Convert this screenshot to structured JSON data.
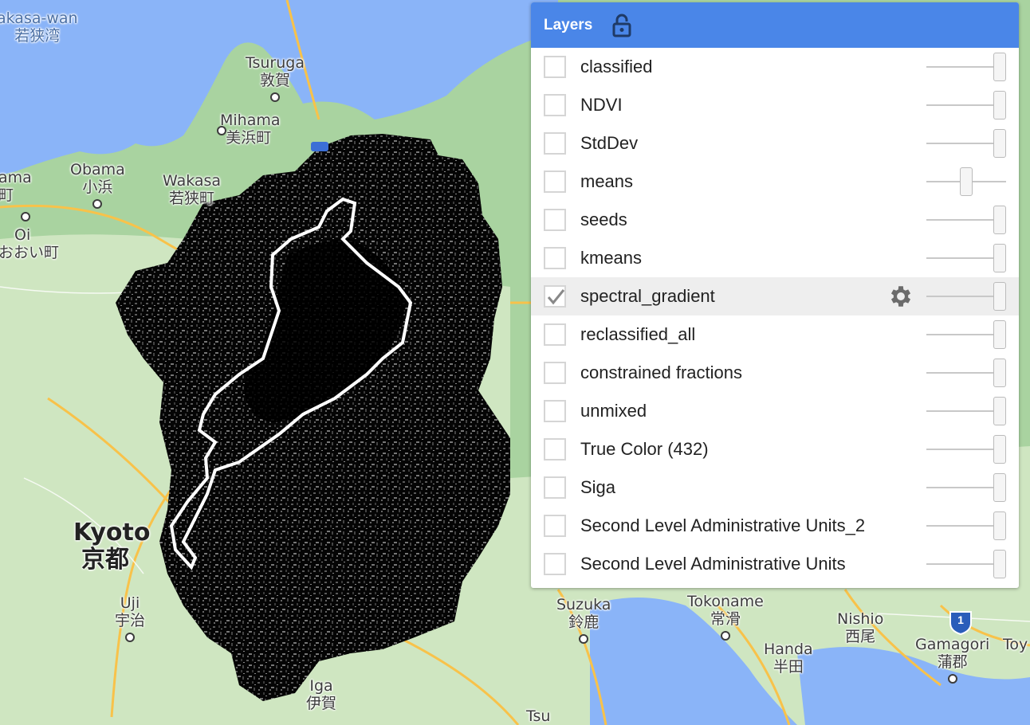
{
  "map": {
    "places": [
      {
        "key": "wakasa-wan",
        "en": "akasa-wan",
        "jp": "若狭湾",
        "water": true
      },
      {
        "key": "tsuruga",
        "en": "Tsuruga",
        "jp": "敦賀"
      },
      {
        "key": "mihama",
        "en": "Mihama",
        "jp": "美浜町"
      },
      {
        "key": "obama",
        "en": "Obama",
        "jp": "小浜"
      },
      {
        "key": "wakasa",
        "en": "Wakasa",
        "jp": "若狭町"
      },
      {
        "key": "ama",
        "en": "ama",
        "jp": "町"
      },
      {
        "key": "oi",
        "en": "Oi",
        "jp": "おおい町"
      },
      {
        "key": "kyoto",
        "en": "Kyoto",
        "jp": "京都",
        "big": true
      },
      {
        "key": "uji",
        "en": "Uji",
        "jp": "宇治"
      },
      {
        "key": "iga",
        "en": "Iga",
        "jp": "伊賀"
      },
      {
        "key": "suzuka",
        "en": "Suzuka",
        "jp": "鈴鹿"
      },
      {
        "key": "tokoname",
        "en": "Tokoname",
        "jp": "常滑"
      },
      {
        "key": "nishio",
        "en": "Nishio",
        "jp": "西尾"
      },
      {
        "key": "handa",
        "en": "Handa",
        "jp": "半田"
      },
      {
        "key": "gamagori",
        "en": "Gamagori",
        "jp": "蒲郡"
      },
      {
        "key": "toy",
        "en": "Toy",
        "jp": ""
      },
      {
        "key": "tsu",
        "en": "Tsu",
        "jp": ""
      }
    ],
    "route_badge": "1"
  },
  "layers_panel": {
    "title": "Layers",
    "lock_icon": "lock-icon",
    "layers": [
      {
        "name": "classified",
        "checked": false,
        "opacity": 1.0
      },
      {
        "name": "NDVI",
        "checked": false,
        "opacity": 1.0
      },
      {
        "name": "StdDev",
        "checked": false,
        "opacity": 1.0
      },
      {
        "name": "means",
        "checked": false,
        "opacity": 0.5
      },
      {
        "name": "seeds",
        "checked": false,
        "opacity": 1.0
      },
      {
        "name": "kmeans",
        "checked": false,
        "opacity": 1.0
      },
      {
        "name": "spectral_gradient",
        "checked": true,
        "opacity": 1.0,
        "highlighted": true,
        "settings_icon": "gear-icon"
      },
      {
        "name": "reclassified_all",
        "checked": false,
        "opacity": 1.0
      },
      {
        "name": "constrained fractions",
        "checked": false,
        "opacity": 1.0
      },
      {
        "name": "unmixed",
        "checked": false,
        "opacity": 1.0
      },
      {
        "name": "True Color (432)",
        "checked": false,
        "opacity": 1.0
      },
      {
        "name": "Siga",
        "checked": false,
        "opacity": 1.0
      },
      {
        "name": "Second Level Administrative Units_2",
        "checked": false,
        "opacity": 1.0
      },
      {
        "name": "Second Level Administrative Units",
        "checked": false,
        "opacity": 1.0
      }
    ]
  },
  "colors": {
    "header": "#4a86e8",
    "water": "#8ab4f8",
    "land": "#a9d3a0",
    "road": "#f8c24a"
  }
}
